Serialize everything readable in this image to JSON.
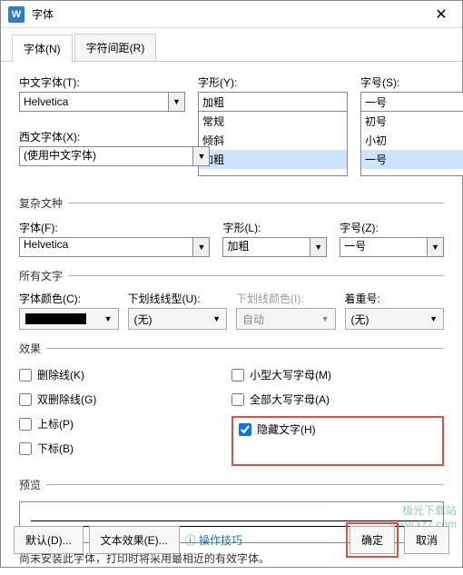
{
  "window": {
    "title": "字体"
  },
  "tabs": {
    "font": "字体(N)",
    "spacing": "字符间距(R)"
  },
  "top": {
    "cjk_label": "中文字体(T):",
    "cjk_value": "Helvetica",
    "style_label": "字形(Y):",
    "style_value": "加粗",
    "style_options": [
      "常规",
      "倾斜",
      "加粗"
    ],
    "size_label": "字号(S):",
    "size_value": "一号",
    "size_options": [
      "初号",
      "小初",
      "一号"
    ],
    "latin_label": "西文字体(X):",
    "latin_value": "(使用中文字体)"
  },
  "complex": {
    "legend": "复杂文种",
    "font_label": "字体(F):",
    "font_value": "Helvetica",
    "style_label": "字形(L):",
    "style_value": "加粗",
    "size_label": "字号(Z):",
    "size_value": "一号"
  },
  "all": {
    "legend": "所有文字",
    "color_label": "字体颜色(C):",
    "uline_label": "下划线线型(U):",
    "uline_value": "(无)",
    "ucolor_label": "下划线颜色(I):",
    "ucolor_value": "自动",
    "emph_label": "着重号:",
    "emph_value": "(无)"
  },
  "effects": {
    "legend": "效果",
    "strike": "删除线(K)",
    "dblstrike": "双删除线(G)",
    "super": "上标(P)",
    "sub": "下标(B)",
    "smallcaps": "小型大写字母(M)",
    "allcaps": "全部大写字母(A)",
    "hidden": "隐藏文字(H)"
  },
  "preview": {
    "legend": "预览"
  },
  "note": "尚未安装此字体，打印时将采用最相近的有效字体。",
  "footer": {
    "default": "默认(D)...",
    "texteffect": "文本效果(E)...",
    "tip": "操作技巧",
    "ok": "确定",
    "cancel": "取消"
  },
  "watermark": {
    "l1": "极光下载站",
    "l2": "www.xz7.com"
  }
}
